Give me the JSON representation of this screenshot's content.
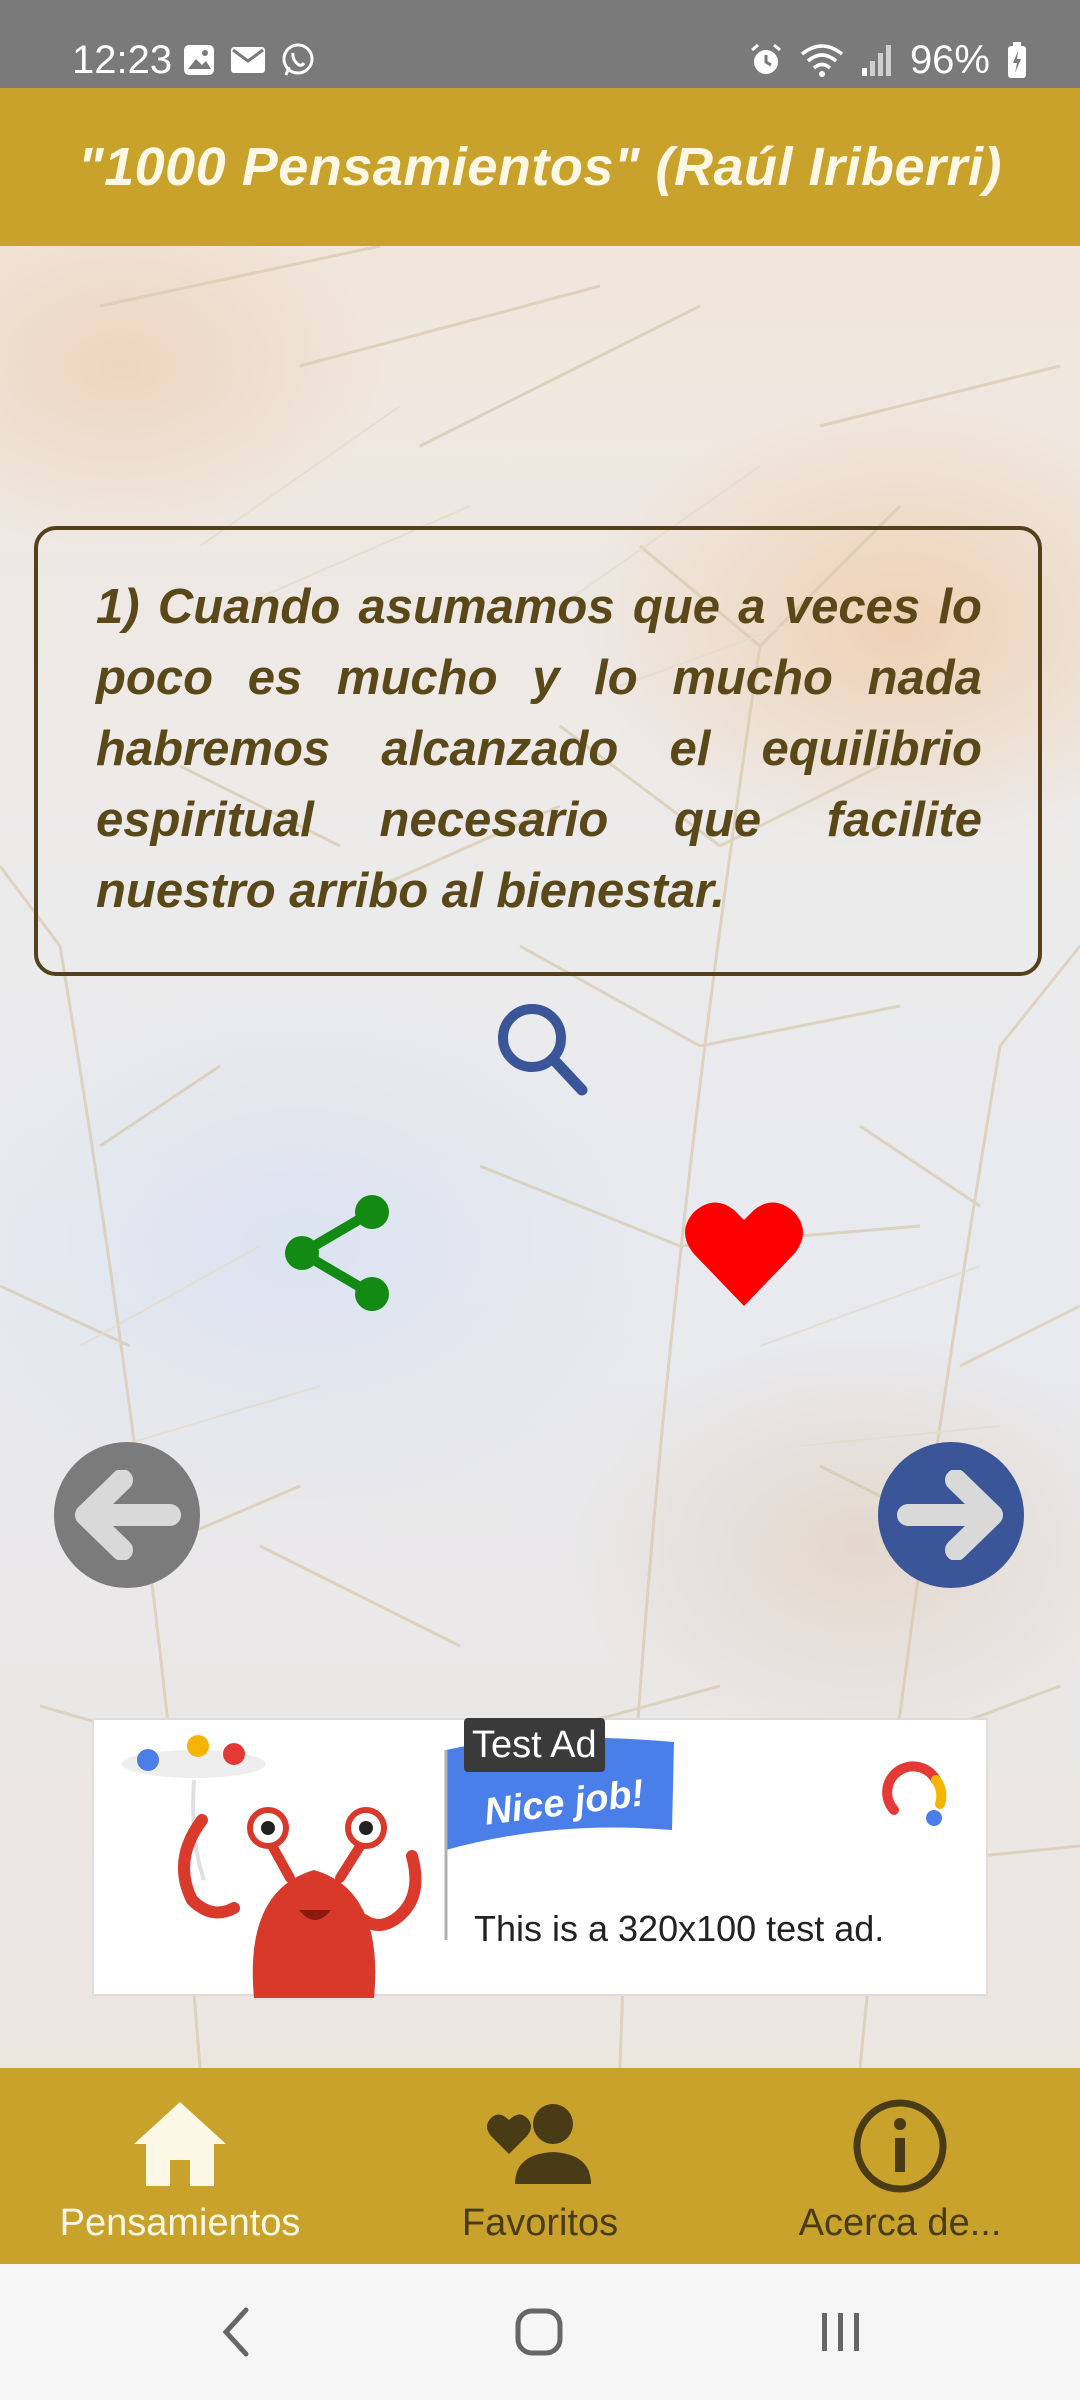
{
  "status_bar": {
    "time": "12:23",
    "left_icons": [
      "gallery-icon",
      "mail-icon",
      "whatsapp-icon"
    ],
    "right_icons": [
      "alarm-icon",
      "wifi-icon",
      "signal-icon",
      "battery-charging-icon"
    ],
    "battery": "96%"
  },
  "header": {
    "title": "\"1000 Pensamientos\" (Raúl Iriberri)"
  },
  "quote": {
    "text": "1) Cuando asumamos que a veces lo poco es mucho y lo mucho nada habremos alcanzado el equilibrio espiritual necesario que facilite nuestro arribo al bienestar."
  },
  "actions": {
    "search_icon": "search-icon",
    "share_icon": "share-icon",
    "favorite_icon": "heart-icon",
    "prev_icon": "arrow-left-icon",
    "next_icon": "arrow-right-icon"
  },
  "ad": {
    "label": "Test Ad",
    "banner": "Nice job!",
    "text": "This is a 320x100 test ad."
  },
  "bottom_nav": {
    "items": [
      {
        "label": "Pensamientos",
        "icon": "home-icon",
        "active": true
      },
      {
        "label": "Favoritos",
        "icon": "favorite-person-icon",
        "active": false
      },
      {
        "label": "Acerca de...",
        "icon": "info-icon",
        "active": false
      }
    ]
  },
  "colors": {
    "accent": "#c9a22c",
    "quote_text": "#5b4819",
    "share": "#138a13",
    "heart": "#ff0000",
    "search": "#3a5598",
    "prev_button": "#7b7b7b",
    "next_button": "#3a5598"
  }
}
